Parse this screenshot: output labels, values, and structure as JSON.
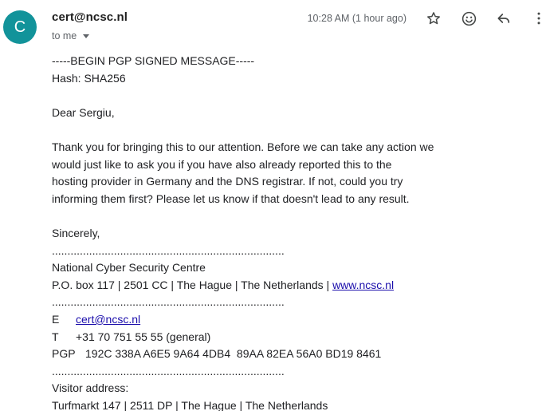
{
  "header": {
    "avatar_letter": "C",
    "sender": "cert@ncsc.nl",
    "recipient": "to me",
    "timestamp": "10:28 AM (1 hour ago)",
    "icons": [
      "star-icon",
      "emoji-icon",
      "reply-icon",
      "more-vertical-icon"
    ]
  },
  "body": {
    "pgp_begin": "-----BEGIN PGP SIGNED MESSAGE-----",
    "hash": "Hash: SHA256",
    "greeting": "Dear Sergiu,",
    "paragraph_lines": [
      "Thank you for bringing this to our attention. Before we can take any action we",
      "would just like to ask you if you have also already reported this to the",
      "hosting provider in Germany and the DNS registrar. If not, could you try",
      "informing them first? Please let us know if that doesn't lead to any result."
    ],
    "signoff": "Sincerely,",
    "separator": "...........................................................................",
    "org_name": "National Cyber Security Centre",
    "org_address_prefix": "P.O. box 117 | 2501 CC | The Hague | The Netherlands | ",
    "org_website": "www.ncsc.nl",
    "email_label": "E",
    "email_value": "cert@ncsc.nl",
    "phone_label": "T",
    "phone_value": "+31 70 751 55 55 (general)",
    "pgp_label": "PGP",
    "pgp_value": "192C 338A A6E5 9A64 4DB4  89AA 82EA 56A0 BD19 8461",
    "visitor_label": "Visitor address:",
    "visitor_address": "Turfmarkt 147 | 2511 DP | The Hague | The Netherlands"
  }
}
